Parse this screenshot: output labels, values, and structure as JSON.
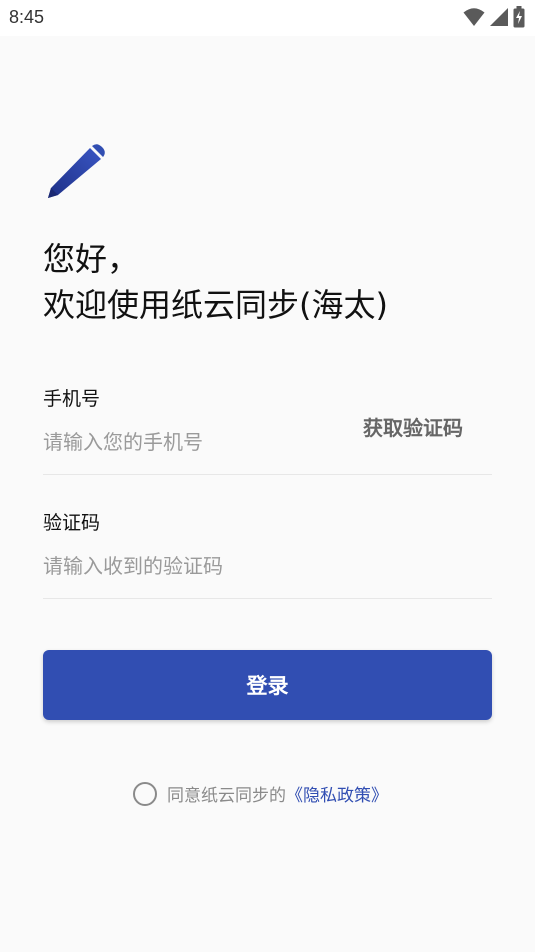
{
  "status_bar": {
    "time": "8:45"
  },
  "app": {
    "greeting_line1": "您好，",
    "greeting_line2": "欢迎使用纸云同步(海太)"
  },
  "phone": {
    "label": "手机号",
    "placeholder": "请输入您的手机号",
    "value": "",
    "get_code_label": "获取验证码"
  },
  "code": {
    "label": "验证码",
    "placeholder": "请输入收到的验证码",
    "value": ""
  },
  "login_button": {
    "label": "登录"
  },
  "agreement": {
    "checked": false,
    "text": "同意纸云同步的",
    "policy_link": "《隐私政策》"
  },
  "colors": {
    "accent": "#314eb2",
    "background": "#fafafa",
    "muted_text": "#8a8a8a"
  },
  "icons": {
    "logo": "pen-icon",
    "wifi": "wifi-icon",
    "signal": "signal-icon",
    "battery": "battery-charging-icon"
  }
}
